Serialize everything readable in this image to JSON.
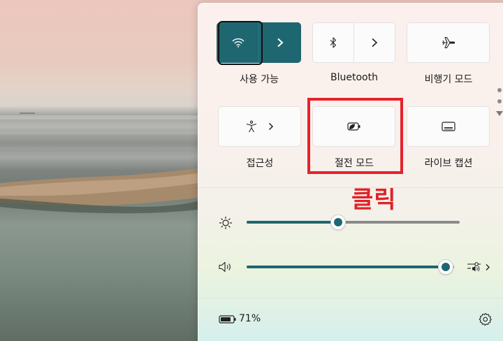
{
  "tiles": {
    "wifi_label": "사용 가능",
    "bluetooth_label": "Bluetooth",
    "airplane_label": "비행기 모드",
    "accessibility_label": "접근성",
    "battery_saver_label": "절전 모드",
    "live_captions_label": "라이브 캡션"
  },
  "annotation": {
    "text": "클릭",
    "color": "#e5222a"
  },
  "brightness": {
    "level": 0.43
  },
  "volume": {
    "level": 0.96
  },
  "battery": {
    "percent_label": "71%"
  },
  "colors": {
    "accent": "#1f6770",
    "annotation": "#e5222a"
  },
  "icons": [
    "wifi-icon",
    "chevron-right-icon",
    "bluetooth-icon",
    "airplane-icon",
    "accessibility-icon",
    "battery-saver-icon",
    "live-captions-icon",
    "brightness-icon",
    "volume-icon",
    "audio-output-icon",
    "battery-icon",
    "settings-gear-icon"
  ]
}
